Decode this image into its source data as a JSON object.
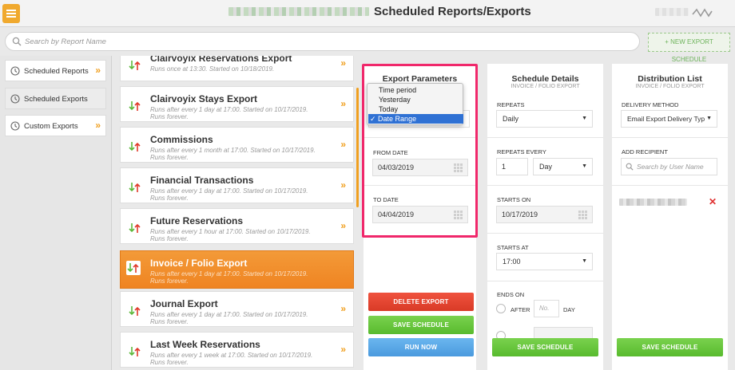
{
  "header": {
    "title": "Scheduled Reports/Exports",
    "menu_icon": "hamburger-icon",
    "logo_icon": "brand-logo-icon",
    "accent": "#f0a92e"
  },
  "search": {
    "placeholder": "Search by Report Name",
    "new_export_label": "+ NEW EXPORT SCHEDULE"
  },
  "sidebar": {
    "items": [
      {
        "label": "Scheduled Reports",
        "icon": "clock-icon",
        "active": false
      },
      {
        "label": "Scheduled Exports",
        "icon": "clock-icon",
        "active": true
      },
      {
        "label": "Custom Exports",
        "icon": "clock-icon",
        "active": false
      }
    ]
  },
  "reports": [
    {
      "title": "Clairvoyix Reservations Export",
      "sub": "Runs once at 13:30. Started on 10/18/2019."
    },
    {
      "title": "Clairvoyix Stays Export",
      "sub": "Runs after every 1 day at 17:00. Started on 10/17/2019. Runs forever."
    },
    {
      "title": "Commissions",
      "sub": "Runs after every 1 month at 17:00. Started on 10/17/2019. Runs forever."
    },
    {
      "title": "Financial Transactions",
      "sub": "Runs after every 1 day at 17:00. Started on 10/17/2019. Runs forever."
    },
    {
      "title": "Future Reservations",
      "sub": "Runs after every 1 hour at 17:00. Started on 10/17/2019. Runs forever."
    },
    {
      "title": "Invoice / Folio Export",
      "sub": "Runs after every 1 day at 17:00. Started on 10/17/2019. Runs forever."
    },
    {
      "title": "Journal Export",
      "sub": "Runs after every 1 day at 17:00. Started on 10/17/2019. Runs forever."
    },
    {
      "title": "Last Week Reservations",
      "sub": "Runs after every 1 week at 17:00. Started on 10/17/2019. Runs forever."
    }
  ],
  "export_params": {
    "title": "Export Parameters",
    "options": [
      "Time period",
      "Yesterday",
      "Today",
      "Date Range"
    ],
    "selected_option": "✓ Date Range",
    "from_label": "FROM DATE",
    "from_value": "04/03/2019",
    "to_label": "TO DATE",
    "to_value": "04/04/2019",
    "delete_label": "DELETE EXPORT",
    "save_label": "SAVE SCHEDULE",
    "run_label": "RUN NOW"
  },
  "schedule": {
    "title": "Schedule Details",
    "subtitle": "INVOICE / FOLIO EXPORT",
    "repeats_label": "REPEATS",
    "repeats_value": "Daily",
    "repeats_every_label": "REPEATS EVERY",
    "repeats_every_num": "1",
    "repeats_every_unit": "Day",
    "starts_on_label": "STARTS ON",
    "starts_on_value": "10/17/2019",
    "starts_at_label": "STARTS AT",
    "starts_at_value": "17:00",
    "ends_on_label": "ENDS ON",
    "after_label": "AFTER",
    "after_placeholder": "No.",
    "day_label": "DAY",
    "save_label": "SAVE SCHEDULE"
  },
  "distribution": {
    "title": "Distribution List",
    "subtitle": "INVOICE / FOLIO EXPORT",
    "delivery_label": "DELIVERY METHOD",
    "delivery_value": "Email Export Delivery Type",
    "recipient_label": "ADD RECIPIENT",
    "recipient_placeholder": "Search by User Name",
    "remove_icon": "close-icon",
    "save_label": "SAVE SCHEDULE"
  }
}
